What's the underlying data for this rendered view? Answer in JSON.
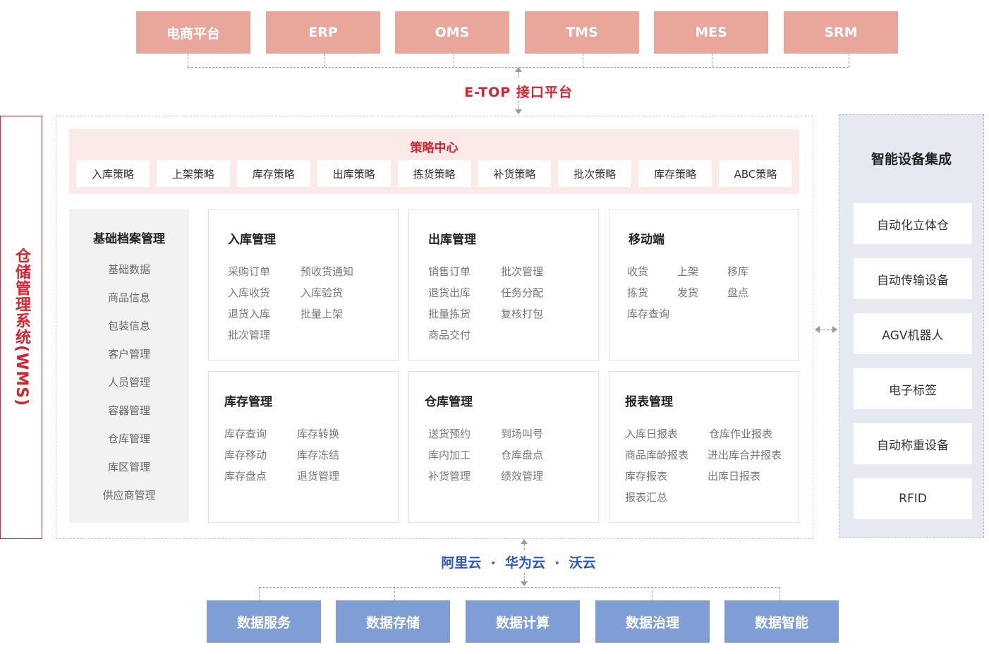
{
  "top_systems": [
    "电商平台",
    "ERP",
    "OMS",
    "TMS",
    "MES",
    "SRM"
  ],
  "interface_platform": "E-TOP 接口平台",
  "wms_label": "仓储管理系统(WMS)",
  "strategy_center": {
    "title": "策略中心",
    "items": [
      "入库策略",
      "上架策略",
      "库存策略",
      "出库策略",
      "拣货策略",
      "补货策略",
      "批次策略",
      "库存策略",
      "ABC策略"
    ]
  },
  "basic_archive": {
    "title": "基础档案管理",
    "items": [
      "基础数据",
      "商品信息",
      "包装信息",
      "客户管理",
      "人员管理",
      "容器管理",
      "仓库管理",
      "库区管理",
      "供应商管理"
    ]
  },
  "modules": [
    {
      "title": "入库管理",
      "col1": [
        "采购订单",
        "入库收货",
        "退货入库",
        "批次管理"
      ],
      "col2": [
        "预收货通知",
        "入库验货",
        "批量上架"
      ]
    },
    {
      "title": "出库管理",
      "col1": [
        "销售订单",
        "退货出库",
        "批量拣货",
        "商品交付"
      ],
      "col2": [
        "批次管理",
        "任务分配",
        "复核打包"
      ]
    },
    {
      "title": "移动端",
      "col1": [
        "收货",
        "拣货",
        "库存查询"
      ],
      "col2": [
        "上架",
        "发货"
      ],
      "col3": [
        "移库",
        "盘点"
      ]
    },
    {
      "title": "库存管理",
      "col1": [
        "库存查询",
        "库存移动",
        "库存盘点"
      ],
      "col2": [
        "库存转换",
        "库存冻结",
        "退货管理"
      ]
    },
    {
      "title": "仓库管理",
      "col1": [
        "送货预约",
        "库内加工",
        "补货管理"
      ],
      "col2": [
        "到场叫号",
        "仓库盘点",
        "绩效管理"
      ]
    },
    {
      "title": "报表管理",
      "col1": [
        "入库日报表",
        "商品库龄报表",
        "库存报表",
        "报表汇总"
      ],
      "col2": [
        "仓库作业报表",
        "进出库合并报表",
        "出库日报表"
      ]
    }
  ],
  "smart_devices": {
    "title": "智能设备集成",
    "items": [
      "自动化立体仓",
      "自动传输设备",
      "AGV机器人",
      "电子标签",
      "自动称重设备",
      "RFID"
    ]
  },
  "cloud_providers": "阿里云  ·  华为云  ·  沃云",
  "data_services": [
    "数据服务",
    "数据存储",
    "数据计算",
    "数据治理",
    "数据智能"
  ],
  "colors": {
    "accent_red": "#d9232e",
    "top_box": "#e9a69b",
    "bottom_box": "#7f9ed6",
    "cloud_blue": "#2a56c6"
  }
}
